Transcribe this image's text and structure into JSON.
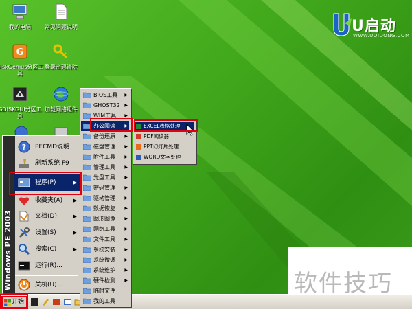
{
  "desktop": {
    "icons": [
      {
        "label": "我的电脑",
        "icon": "my-computer-icon"
      },
      {
        "label": "常见问题说明",
        "icon": "document-icon"
      },
      {
        "label": "DiskGenius分区工具",
        "icon": "diskgenius-icon"
      },
      {
        "label": "登录密码清除",
        "icon": "key-icon"
      },
      {
        "label": "GDISKGUI分区工具",
        "icon": "gdisk-icon"
      },
      {
        "label": "加载网络组件",
        "icon": "network-globe-icon"
      }
    ]
  },
  "logo": {
    "brand": "U启动",
    "url": "WWW.UQIDONG.COM"
  },
  "watermark": "软件技巧",
  "start_menu": {
    "sidebar": "Windows PE 2003",
    "items": [
      {
        "label": "PECMD说明",
        "icon": "help-icon",
        "arrow": ""
      },
      {
        "label": "刷新系统 F9",
        "icon": "brush-icon",
        "arrow": ""
      },
      {
        "label": "程序(P)",
        "icon": "programs-icon",
        "arrow": "▶"
      },
      {
        "label": "收藏夹(A)",
        "icon": "favorites-icon",
        "arrow": "▶"
      },
      {
        "label": "文档(D)",
        "icon": "documents-icon",
        "arrow": "▶"
      },
      {
        "label": "设置(S)",
        "icon": "settings-icon",
        "arrow": "▶"
      },
      {
        "label": "搜索(C)",
        "icon": "search-icon",
        "arrow": "▶"
      },
      {
        "label": "运行(R)...",
        "icon": "run-icon",
        "arrow": ""
      },
      {
        "label": "关机(U)...",
        "icon": "shutdown-icon",
        "arrow": ""
      }
    ]
  },
  "programs_menu": {
    "items": [
      {
        "label": "BIOS工具",
        "arrow": "▶"
      },
      {
        "label": "GHOST32",
        "arrow": "▶"
      },
      {
        "label": "WIM工具",
        "arrow": "▶"
      },
      {
        "label": "办公阅读",
        "arrow": "▶"
      },
      {
        "label": "备份还原",
        "arrow": "▶"
      },
      {
        "label": "磁盘管理",
        "arrow": "▶"
      },
      {
        "label": "附件工具",
        "arrow": "▶"
      },
      {
        "label": "管理工具",
        "arrow": "▶"
      },
      {
        "label": "光盘工具",
        "arrow": "▶"
      },
      {
        "label": "密码管理",
        "arrow": "▶"
      },
      {
        "label": "驱动管理",
        "arrow": "▶"
      },
      {
        "label": "数据恢复",
        "arrow": "▶"
      },
      {
        "label": "图形图像",
        "arrow": "▶"
      },
      {
        "label": "网络工具",
        "arrow": "▶"
      },
      {
        "label": "文件工具",
        "arrow": "▶"
      },
      {
        "label": "系统安装",
        "arrow": "▶"
      },
      {
        "label": "系统微调",
        "arrow": "▶"
      },
      {
        "label": "系统维护",
        "arrow": "▶"
      },
      {
        "label": "硬件检测",
        "arrow": "▶"
      },
      {
        "label": "临时文件",
        "arrow": ""
      },
      {
        "label": "我的工具",
        "arrow": ""
      }
    ]
  },
  "office_menu": {
    "items": [
      {
        "label": "EXCEL表格处理"
      },
      {
        "label": "PDF阅读器"
      },
      {
        "label": "PPT幻灯片处理"
      },
      {
        "label": "WORD文字处理"
      }
    ]
  },
  "taskbar": {
    "start_label": "开始"
  },
  "colors": {
    "highlight": "#0a246a",
    "annotation_red": "#e00010",
    "desktop_green": "#3fa51a"
  }
}
